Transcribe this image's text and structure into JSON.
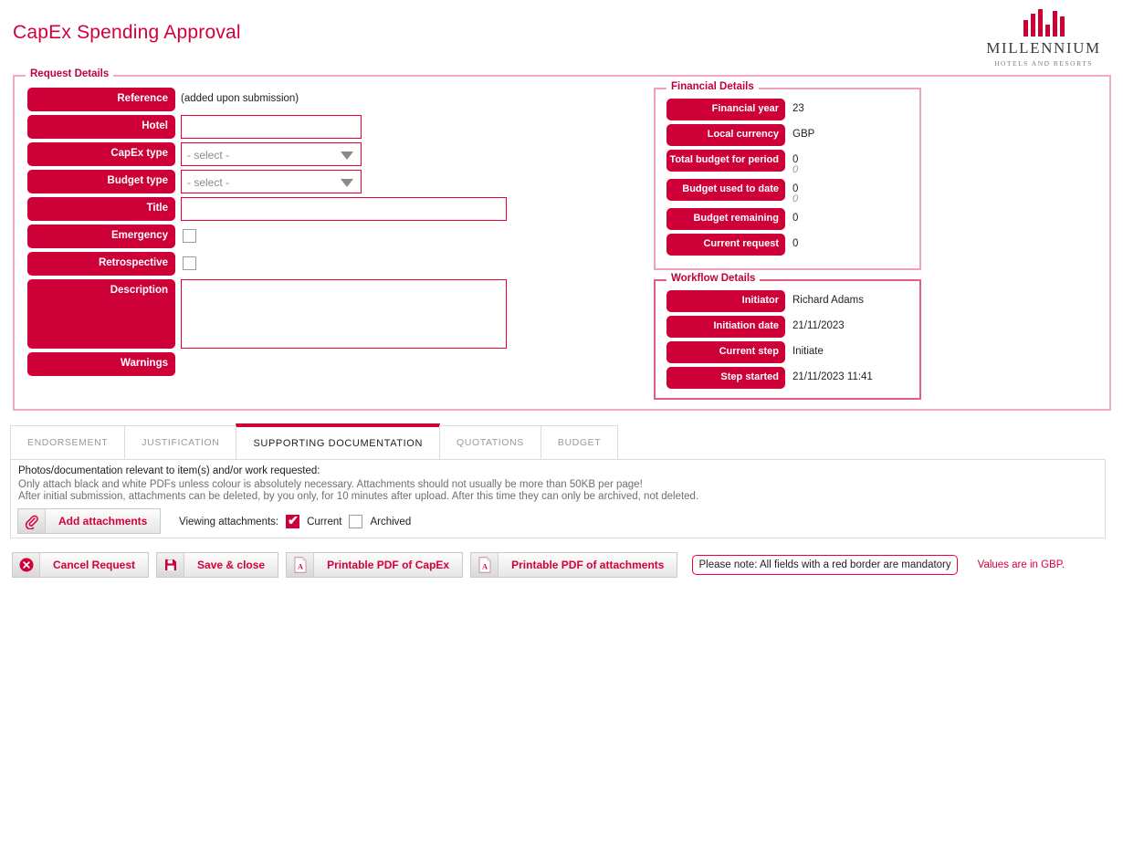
{
  "header": {
    "page_title": "CapEx Spending Approval",
    "logo": {
      "name": "MILLENNIUM",
      "subtitle": "HOTELS AND RESORTS",
      "bars": [
        60,
        82,
        100,
        45,
        92,
        72
      ],
      "color": "#cc0033"
    }
  },
  "colors": {
    "brand_crimson": "#ce0038",
    "title_red": "#d4003c",
    "mandatory_border": "#e8002e",
    "panel_pink": "#f2a9c1"
  },
  "request_details": {
    "legend": "Request Details",
    "rows": [
      {
        "label": "Reference",
        "type": "static",
        "value": "(added upon submission)"
      },
      {
        "label": "Hotel",
        "type": "text",
        "value": "",
        "placeholder": ""
      },
      {
        "label": "CapEx type",
        "type": "select",
        "value": "- select -"
      },
      {
        "label": "Budget type",
        "type": "select",
        "value": "- select -"
      },
      {
        "label": "Title",
        "type": "text",
        "value": "",
        "placeholder": ""
      },
      {
        "label": "Emergency",
        "type": "checkbox",
        "checked": false
      },
      {
        "label": "Retrospective",
        "type": "checkbox",
        "checked": false
      },
      {
        "label": "Description",
        "type": "textarea",
        "value": "",
        "placeholder": ""
      },
      {
        "label": "Warnings",
        "type": "static",
        "value": ""
      }
    ]
  },
  "financial_details": {
    "legend": "Financial Details",
    "rows": [
      {
        "label": "Financial year",
        "value": "23",
        "sub": ""
      },
      {
        "label": "Local currency",
        "value": "GBP",
        "sub": ""
      },
      {
        "label": "Total budget for period",
        "value": "0",
        "sub": "0"
      },
      {
        "label": "Budget used to date",
        "value": "0",
        "sub": "0"
      },
      {
        "label": "Budget remaining",
        "value": "0",
        "sub": ""
      },
      {
        "label": "Current request",
        "value": "0",
        "sub": ""
      }
    ]
  },
  "workflow_details": {
    "legend": "Workflow Details",
    "rows": [
      {
        "label": "Initiator",
        "value": "Richard Adams"
      },
      {
        "label": "Initiation date",
        "value": "21/11/2023"
      },
      {
        "label": "Current step",
        "value": "Initiate"
      },
      {
        "label": "Step started",
        "value": "21/11/2023 11:41"
      }
    ]
  },
  "tabs": [
    {
      "label": "ENDORSEMENT",
      "active": false
    },
    {
      "label": "JUSTIFICATION",
      "active": false
    },
    {
      "label": "SUPPORTING DOCUMENTATION",
      "active": true
    },
    {
      "label": "QUOTATIONS",
      "active": false
    },
    {
      "label": "BUDGET",
      "active": false
    }
  ],
  "supporting_documentation": {
    "line1": "Photos/documentation relevant to item(s) and/or work requested:",
    "line2": "Only attach black and white PDFs unless colour is absolutely necessary. Attachments should not usually be more than 50KB per page!",
    "line3": "After initial submission, attachments can be deleted, by you only, for 10 minutes after upload. After this time they can only be archived, not deleted.",
    "add_button": "Add attachments",
    "add_button_icon": "paperclip-icon",
    "viewing_label": "Viewing attachments:",
    "filters": [
      {
        "label": "Current",
        "checked": true
      },
      {
        "label": "Archived",
        "checked": false
      }
    ]
  },
  "actions": {
    "buttons": [
      {
        "label": "Cancel Request",
        "icon": "cancel-circle-icon"
      },
      {
        "label": "Save & close",
        "icon": "floppy-disk-icon"
      },
      {
        "label": "Printable PDF of CapEx",
        "icon": "pdf-icon"
      },
      {
        "label": "Printable PDF of attachments",
        "icon": "pdf-icon"
      }
    ],
    "mandatory_note": "Please note: All fields with a red border are mandatory",
    "currency_note": "Values are in GBP."
  }
}
